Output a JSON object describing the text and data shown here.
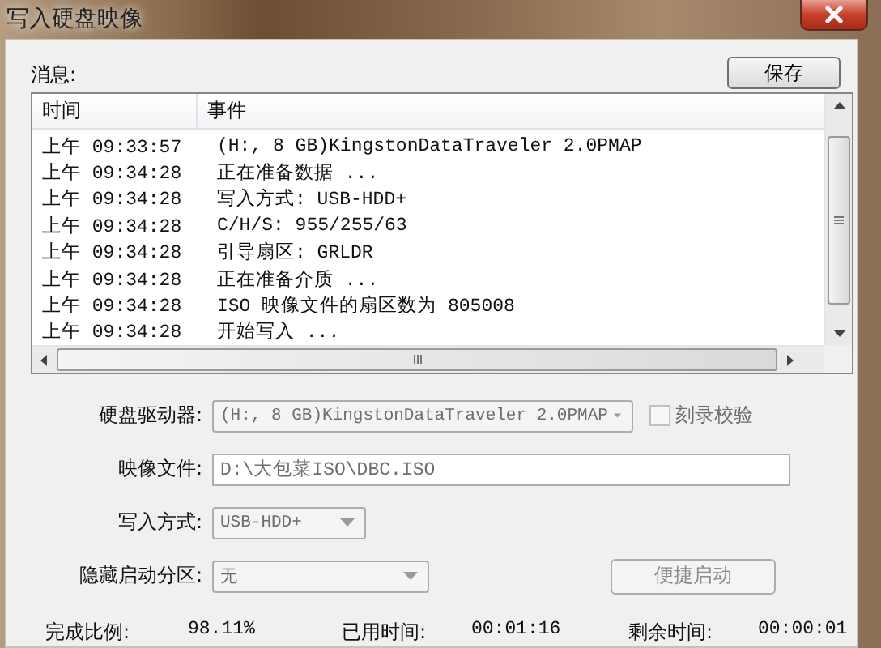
{
  "window": {
    "title": "写入硬盘映像"
  },
  "messages": {
    "label": "消息:",
    "save_button": "保存",
    "columns": [
      "时间",
      "事件"
    ],
    "rows": [
      {
        "time": "上午 09:33:57",
        "event": "(H:, 8 GB)KingstonDataTraveler 2.0PMAP"
      },
      {
        "time": "上午 09:34:28",
        "event": "正在准备数据 ..."
      },
      {
        "time": "上午 09:34:28",
        "event": "写入方式: USB-HDD+"
      },
      {
        "time": "上午 09:34:28",
        "event": "C/H/S: 955/255/63"
      },
      {
        "time": "上午 09:34:28",
        "event": "引导扇区: GRLDR"
      },
      {
        "time": "上午 09:34:28",
        "event": "正在准备介质 ..."
      },
      {
        "time": "上午 09:34:28",
        "event": "ISO 映像文件的扇区数为 805008"
      },
      {
        "time": "上午 09:34:28",
        "event": "开始写入 ..."
      }
    ]
  },
  "form": {
    "fields": [
      {
        "kind": "combo",
        "label": "硬盘驱动器:",
        "value": "(H:, 8 GB)KingstonDataTraveler 2.0PMAP",
        "disabled": true,
        "checkbox": {
          "label": "刻录校验",
          "checked": false,
          "disabled": true
        }
      },
      {
        "kind": "text",
        "label": "映像文件:",
        "value": "D:\\大包菜ISO\\DBC.ISO",
        "disabled": true
      },
      {
        "kind": "combo",
        "label": "写入方式:",
        "value": "USB-HDD+",
        "disabled": true
      },
      {
        "kind": "combo",
        "label": "隐藏启动分区:",
        "value": "无",
        "disabled": true,
        "button": {
          "label": "便捷启动",
          "disabled": true
        }
      }
    ]
  },
  "status": [
    {
      "label": "完成比例:",
      "value": "98.11%"
    },
    {
      "label": "已用时间:",
      "value": "00:01:16"
    },
    {
      "label": "剩余时间:",
      "value": "00:00:01"
    }
  ]
}
